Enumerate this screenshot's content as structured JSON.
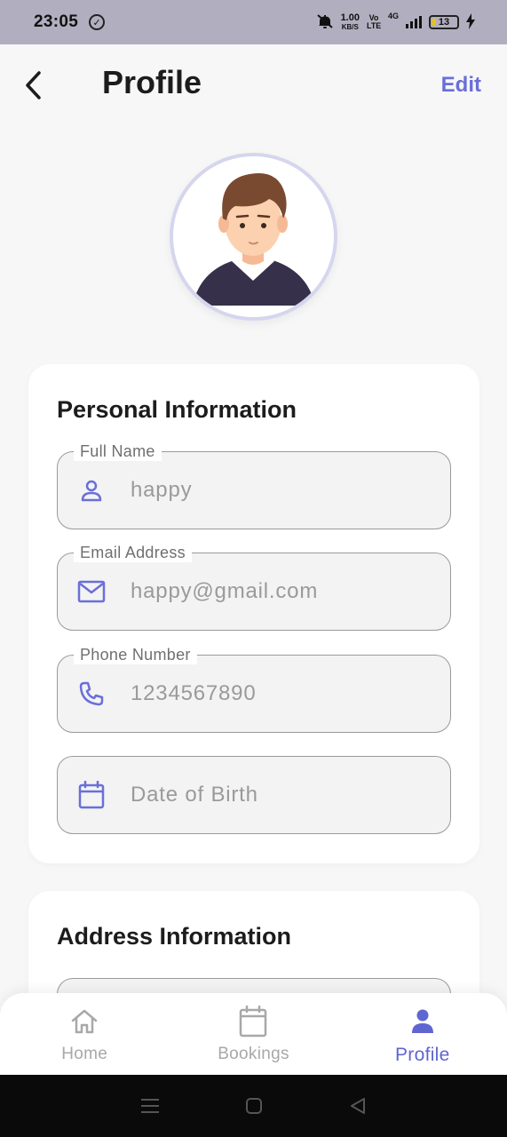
{
  "status_bar": {
    "time": "23:05",
    "network_speed_value": "1.00",
    "network_speed_unit": "KB/S",
    "volte": "Vo LTE",
    "network_type": "4G",
    "battery": "13"
  },
  "header": {
    "title": "Profile",
    "edit_label": "Edit"
  },
  "personal_info": {
    "title": "Personal Information",
    "fields": [
      {
        "label": "Full Name",
        "value": "happy",
        "icon": "person-icon"
      },
      {
        "label": "Email Address",
        "value": "happy@gmail.com",
        "icon": "mail-icon"
      },
      {
        "label": "Phone Number",
        "value": "1234567890",
        "icon": "phone-icon"
      },
      {
        "label": "",
        "placeholder": "Date of Birth",
        "icon": "calendar-icon"
      }
    ]
  },
  "address_info": {
    "title": "Address Information"
  },
  "bottom_nav": {
    "items": [
      {
        "label": "Home",
        "icon": "home-icon",
        "active": false
      },
      {
        "label": "Bookings",
        "icon": "calendar-icon",
        "active": false
      },
      {
        "label": "Profile",
        "icon": "person-icon",
        "active": true
      }
    ]
  },
  "colors": {
    "accent": "#5f65d1",
    "edit": "#6a6fd8",
    "status_bar": "#b1afbf",
    "background": "#f7f7f7"
  }
}
